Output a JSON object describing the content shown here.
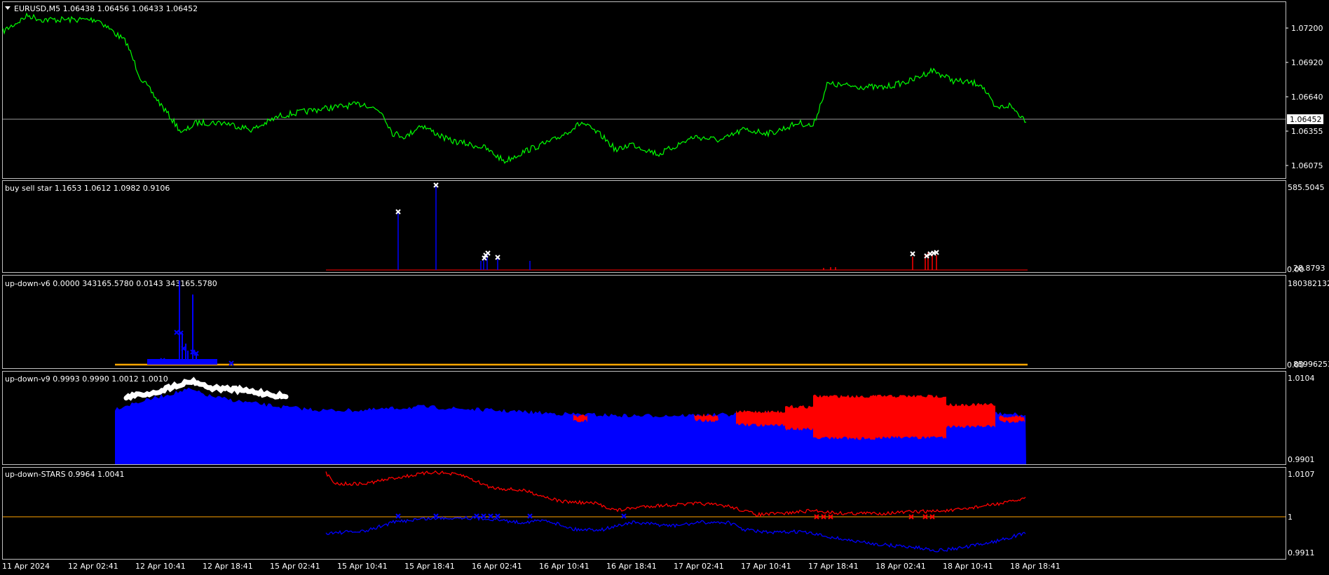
{
  "main": {
    "symbol_line": "EURUSD,M5  1.06438 1.06456 1.06433 1.06452",
    "scale": [
      "1.07200",
      "1.06920",
      "1.06640",
      "1.06355",
      "1.06075"
    ],
    "current_price": "1.06452",
    "line_color": "#00ff00"
  },
  "panes": [
    {
      "title": "buy sell star 1.1653 1.0612 1.0982 0.9106",
      "scale_top": "585.5045",
      "scale_bottom": "28.8793",
      "scale_bottom2": "0.00"
    },
    {
      "title": "up-down-v6 0.0000 343165.5780 0.0143 343165.5780",
      "scale_top": "180382132",
      "scale_bottom": "85996253",
      "scale_bottom2": "0.00"
    },
    {
      "title": "up-down-v9 0.9993 0.9990 1.0012 1.0010",
      "scale_top": "1.0104",
      "scale_bottom": "0.9901"
    },
    {
      "title": "up-down-STARS 0.9964 1.0041",
      "scale_top": "1.0107",
      "scale_mid": "1",
      "scale_bottom": "0.9911"
    }
  ],
  "time_axis": [
    "11 Apr 2024",
    "12 Apr 02:41",
    "12 Apr 10:41",
    "12 Apr 18:41",
    "15 Apr 02:41",
    "15 Apr 10:41",
    "15 Apr 18:41",
    "16 Apr 02:41",
    "16 Apr 10:41",
    "16 Apr 18:41",
    "17 Apr 02:41",
    "17 Apr 10:41",
    "17 Apr 18:41",
    "18 Apr 02:41",
    "18 Apr 10:41",
    "18 Apr 18:41"
  ],
  "colors": {
    "blue": "#0000ff",
    "red": "#ff0000",
    "orange": "#ffa500",
    "white": "#ffffff",
    "border": "#c0c0c0"
  }
}
